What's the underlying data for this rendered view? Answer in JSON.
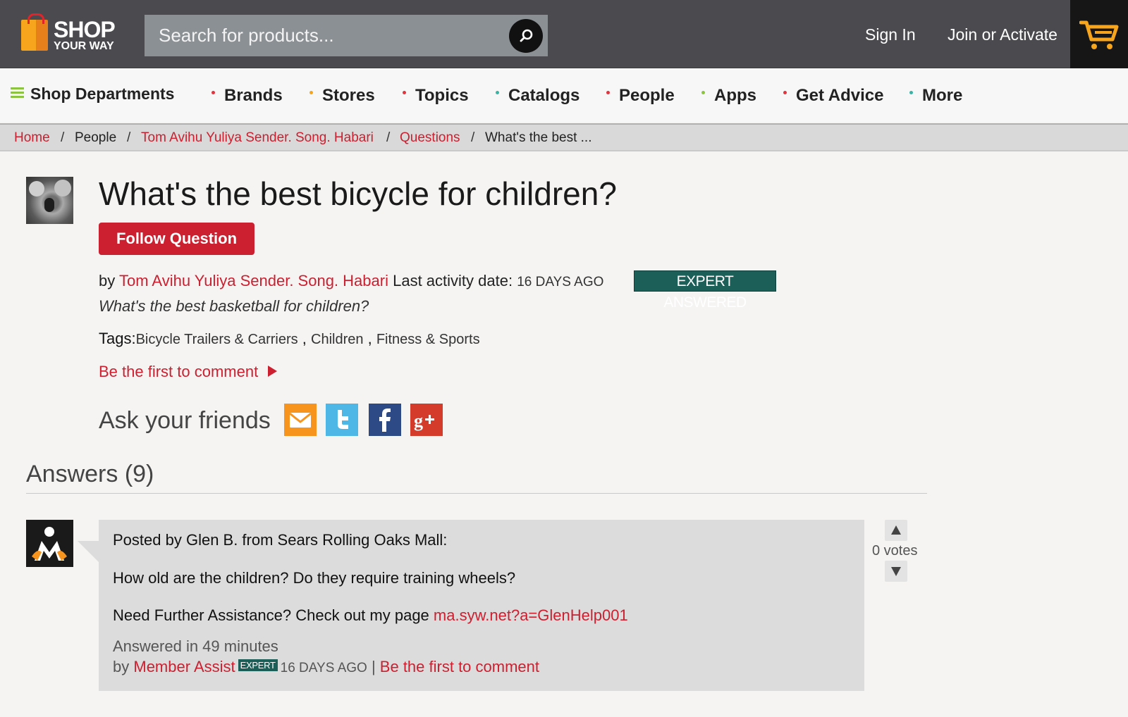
{
  "header": {
    "logo_line1": "SHOP",
    "logo_line2": "YOUR WAY",
    "search_placeholder": "Search for products...",
    "sign_in": "Sign In",
    "join": "Join or Activate",
    "cart_icon": "cart-icon",
    "search_icon": "search-icon"
  },
  "nav": {
    "departments": "Shop Departments",
    "items": [
      {
        "label": "Brands",
        "dot_color": "#e0343f"
      },
      {
        "label": "Stores",
        "dot_color": "#f4a51d"
      },
      {
        "label": "Topics",
        "dot_color": "#e0343f"
      },
      {
        "label": "Catalogs",
        "dot_color": "#3ab3a4"
      },
      {
        "label": "People",
        "dot_color": "#e0343f"
      },
      {
        "label": "Apps",
        "dot_color": "#8cc43f"
      },
      {
        "label": "Get Advice",
        "dot_color": "#e0343f"
      },
      {
        "label": "More",
        "dot_color": "#3ab3a4"
      }
    ]
  },
  "breadcrumb": {
    "items": [
      "Home",
      "People",
      "Tom Avihu Yuliya Sender. Song. Habari",
      "Questions",
      "What's the best ..."
    ]
  },
  "question": {
    "title": "What's the best bicycle for children?",
    "follow_label": "Follow Question",
    "by": "by",
    "author": "Tom Avihu Yuliya Sender. Song. Habari",
    "last_activity_label": "Last activity date:",
    "last_activity_value": "16 DAYS AGO",
    "badge": "EXPERT ANSWERED",
    "subtitle": "What's the best basketball for children?",
    "tags_label": "Tags:",
    "tags": [
      "Bicycle Trailers & Carriers",
      "Children",
      "Fitness & Sports"
    ],
    "first_comment": "Be the first to comment",
    "ask_friends": "Ask your friends",
    "share_icons": [
      "mail-icon",
      "twitter-icon",
      "facebook-icon",
      "google-plus-icon"
    ]
  },
  "answers": {
    "heading": "Answers (9)",
    "items": [
      {
        "posted_by": "Posted by Glen B. from Sears Rolling Oaks Mall:",
        "body": "How old are the children? Do they require training wheels?",
        "assist_prefix": "Need Further Assistance? Check out my page",
        "assist_link": "ma.syw.net?a=GlenHelp001",
        "answered_in": "Answered in 49 minutes",
        "by": "by",
        "author": "Member Assist",
        "expert_badge": "EXPERT",
        "date": "16 DAYS AGO",
        "separator": "|",
        "comment_link": "Be the first to comment",
        "votes": "0 votes"
      }
    ]
  },
  "colors": {
    "brand_red": "#cc1f2f",
    "header_bg": "#4b4b4f",
    "expert_green": "#1c5f59"
  }
}
